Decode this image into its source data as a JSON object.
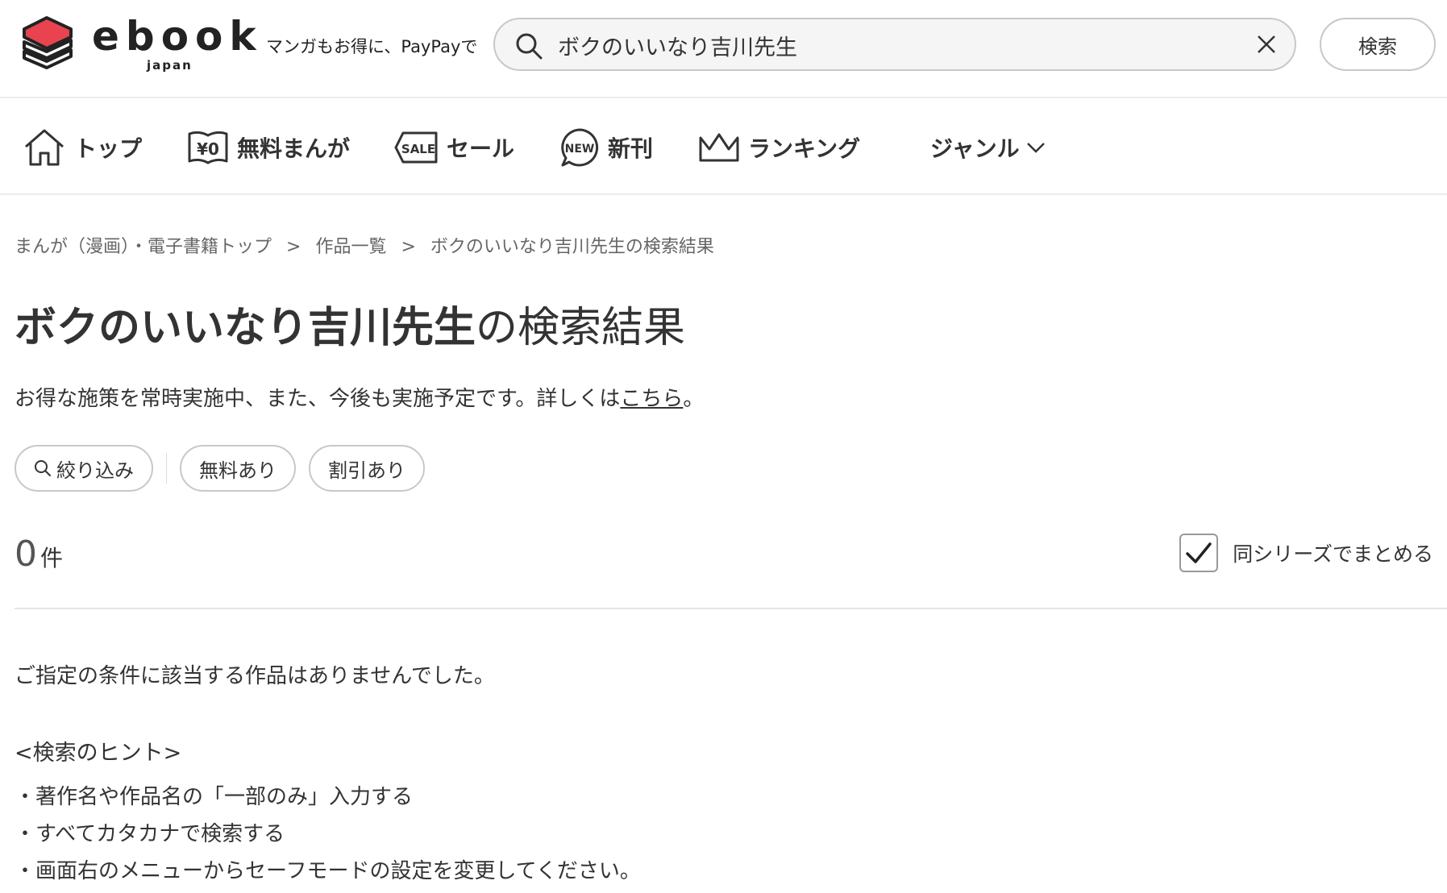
{
  "header": {
    "logo_text": "ebook",
    "logo_sub": "japan",
    "tagline": "マンガもお得に、PayPayで",
    "search": {
      "value": "ボクのいいなり吉川先生",
      "placeholder": ""
    },
    "search_button_label": "検索"
  },
  "nav": {
    "items": [
      {
        "label": "トップ",
        "icon": "home-icon"
      },
      {
        "label": "無料まんが",
        "icon": "free-book-icon"
      },
      {
        "label": "セール",
        "icon": "sale-tag-icon"
      },
      {
        "label": "新刊",
        "icon": "new-badge-icon"
      },
      {
        "label": "ランキング",
        "icon": "crown-icon"
      },
      {
        "label": "ジャンル",
        "icon": "chevron-down-icon"
      }
    ]
  },
  "breadcrumb": {
    "items": [
      "まんが（漫画）・電子書籍トップ",
      "作品一覧",
      "ボクのいいなり吉川先生の検索結果"
    ],
    "separator": ">"
  },
  "page_title": {
    "query": "ボクのいいなり吉川先生",
    "suffix": "の検索結果"
  },
  "notice": {
    "text": "お得な施策を常時実施中、また、今後も実施予定です。詳しくは",
    "link": "こちら",
    "end": "。"
  },
  "filters": {
    "refine_label": "絞り込み",
    "free_label": "無料あり",
    "discount_label": "割引あり"
  },
  "results": {
    "count": "0",
    "unit": "件",
    "group_series_label": "同シリーズでまとめる",
    "group_series_checked": true
  },
  "empty": {
    "message": "ご指定の条件に該当する作品はありませんでした。",
    "hints_title": "<検索のヒント>",
    "hints": [
      "・著作名や作品名の「一部のみ」入力する",
      "・すべてカタカナで検索する",
      "・画面右のメニューからセーフモードの設定を変更してください。"
    ]
  },
  "colors": {
    "brand_red": "#e8434f",
    "text": "#333333",
    "border": "#c8c8c8"
  }
}
